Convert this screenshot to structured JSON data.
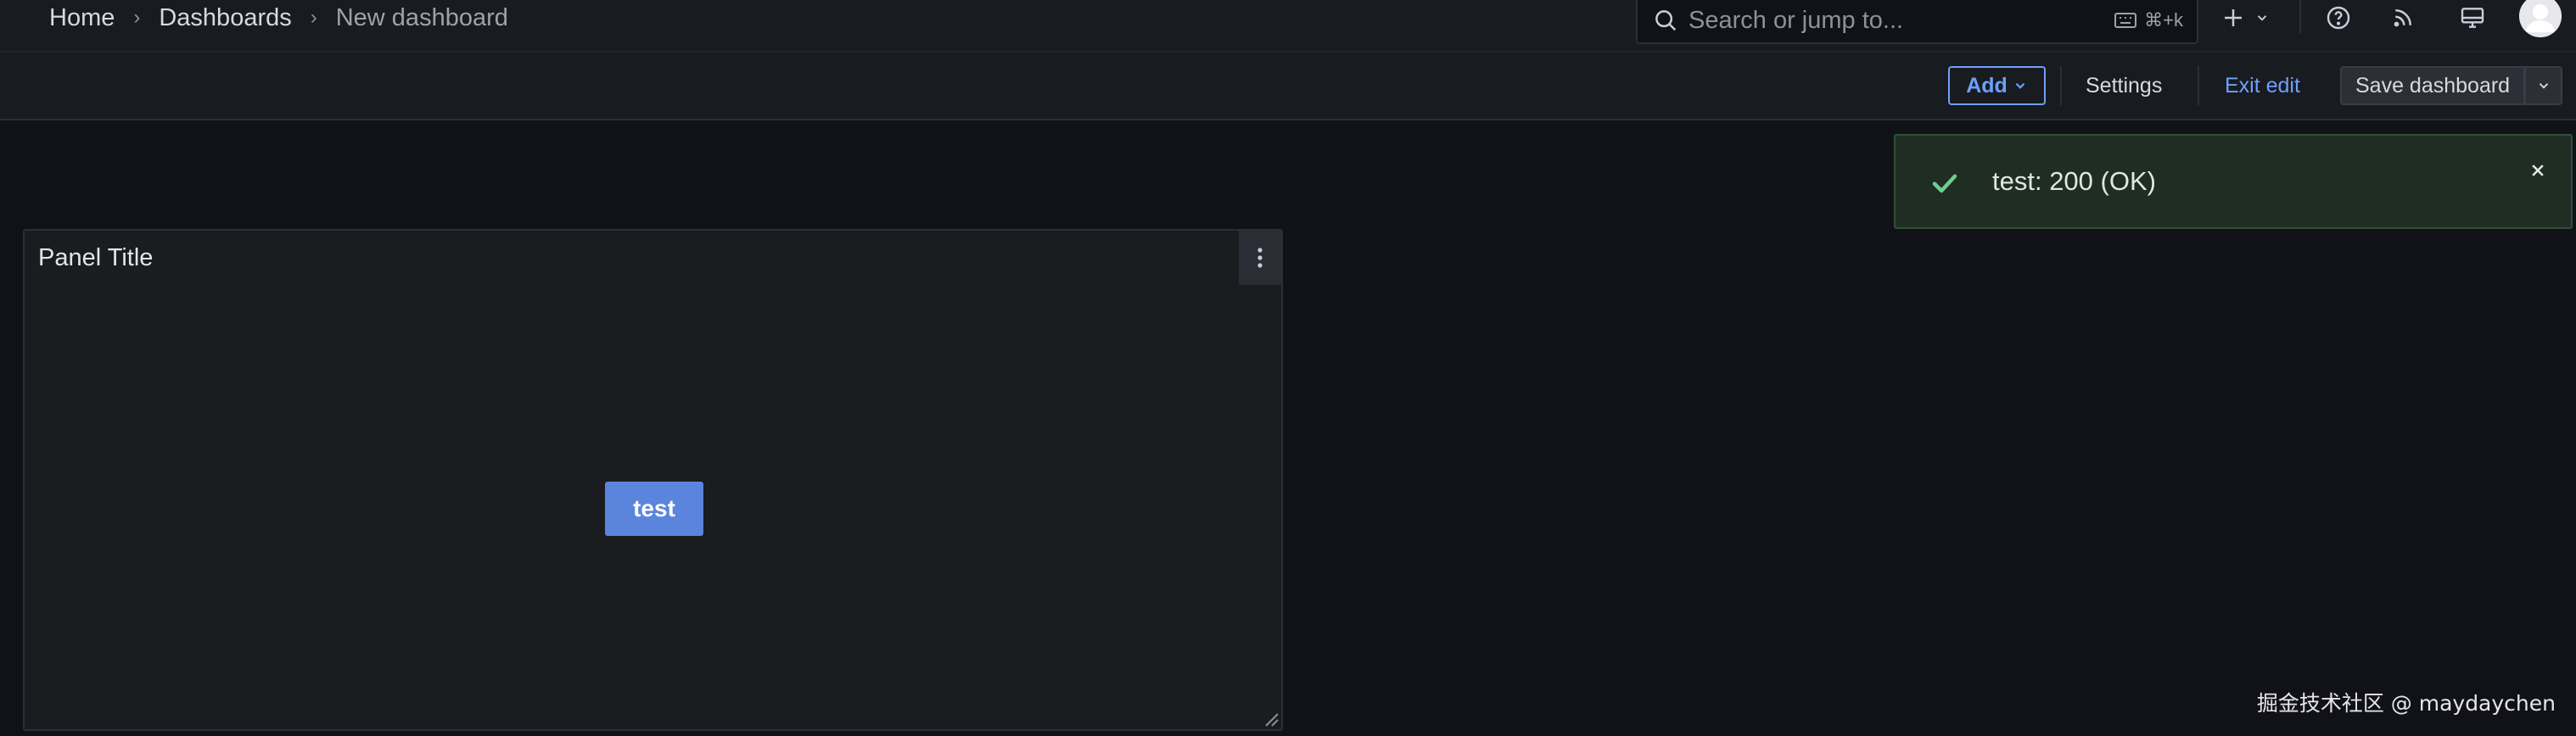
{
  "breadcrumb": {
    "items": [
      "Home",
      "Dashboards",
      "New dashboard"
    ],
    "separator": "›"
  },
  "search": {
    "placeholder": "Search or jump to...",
    "shortcut": "⌘+k"
  },
  "top_icons": [
    "plus-icon",
    "chevron-down-icon",
    "help-icon",
    "rss-icon",
    "monitor-icon",
    "avatar"
  ],
  "toolbar": {
    "add_label": "Add",
    "settings_label": "Settings",
    "exit_edit_label": "Exit edit",
    "save_label": "Save dashboard"
  },
  "panel": {
    "title": "Panel Title",
    "button_label": "test"
  },
  "toast": {
    "message": "test: 200 (OK)",
    "status": "success"
  },
  "watermark": "掘金技术社区 @ maydaychen",
  "colors": {
    "background": "#111217",
    "toolbar": "#181b1f",
    "accent_blue": "#6e9fff",
    "panel_button": "#5b84dc",
    "success_green": "#6ccf8e",
    "toast_bg": "#1f2d23"
  }
}
